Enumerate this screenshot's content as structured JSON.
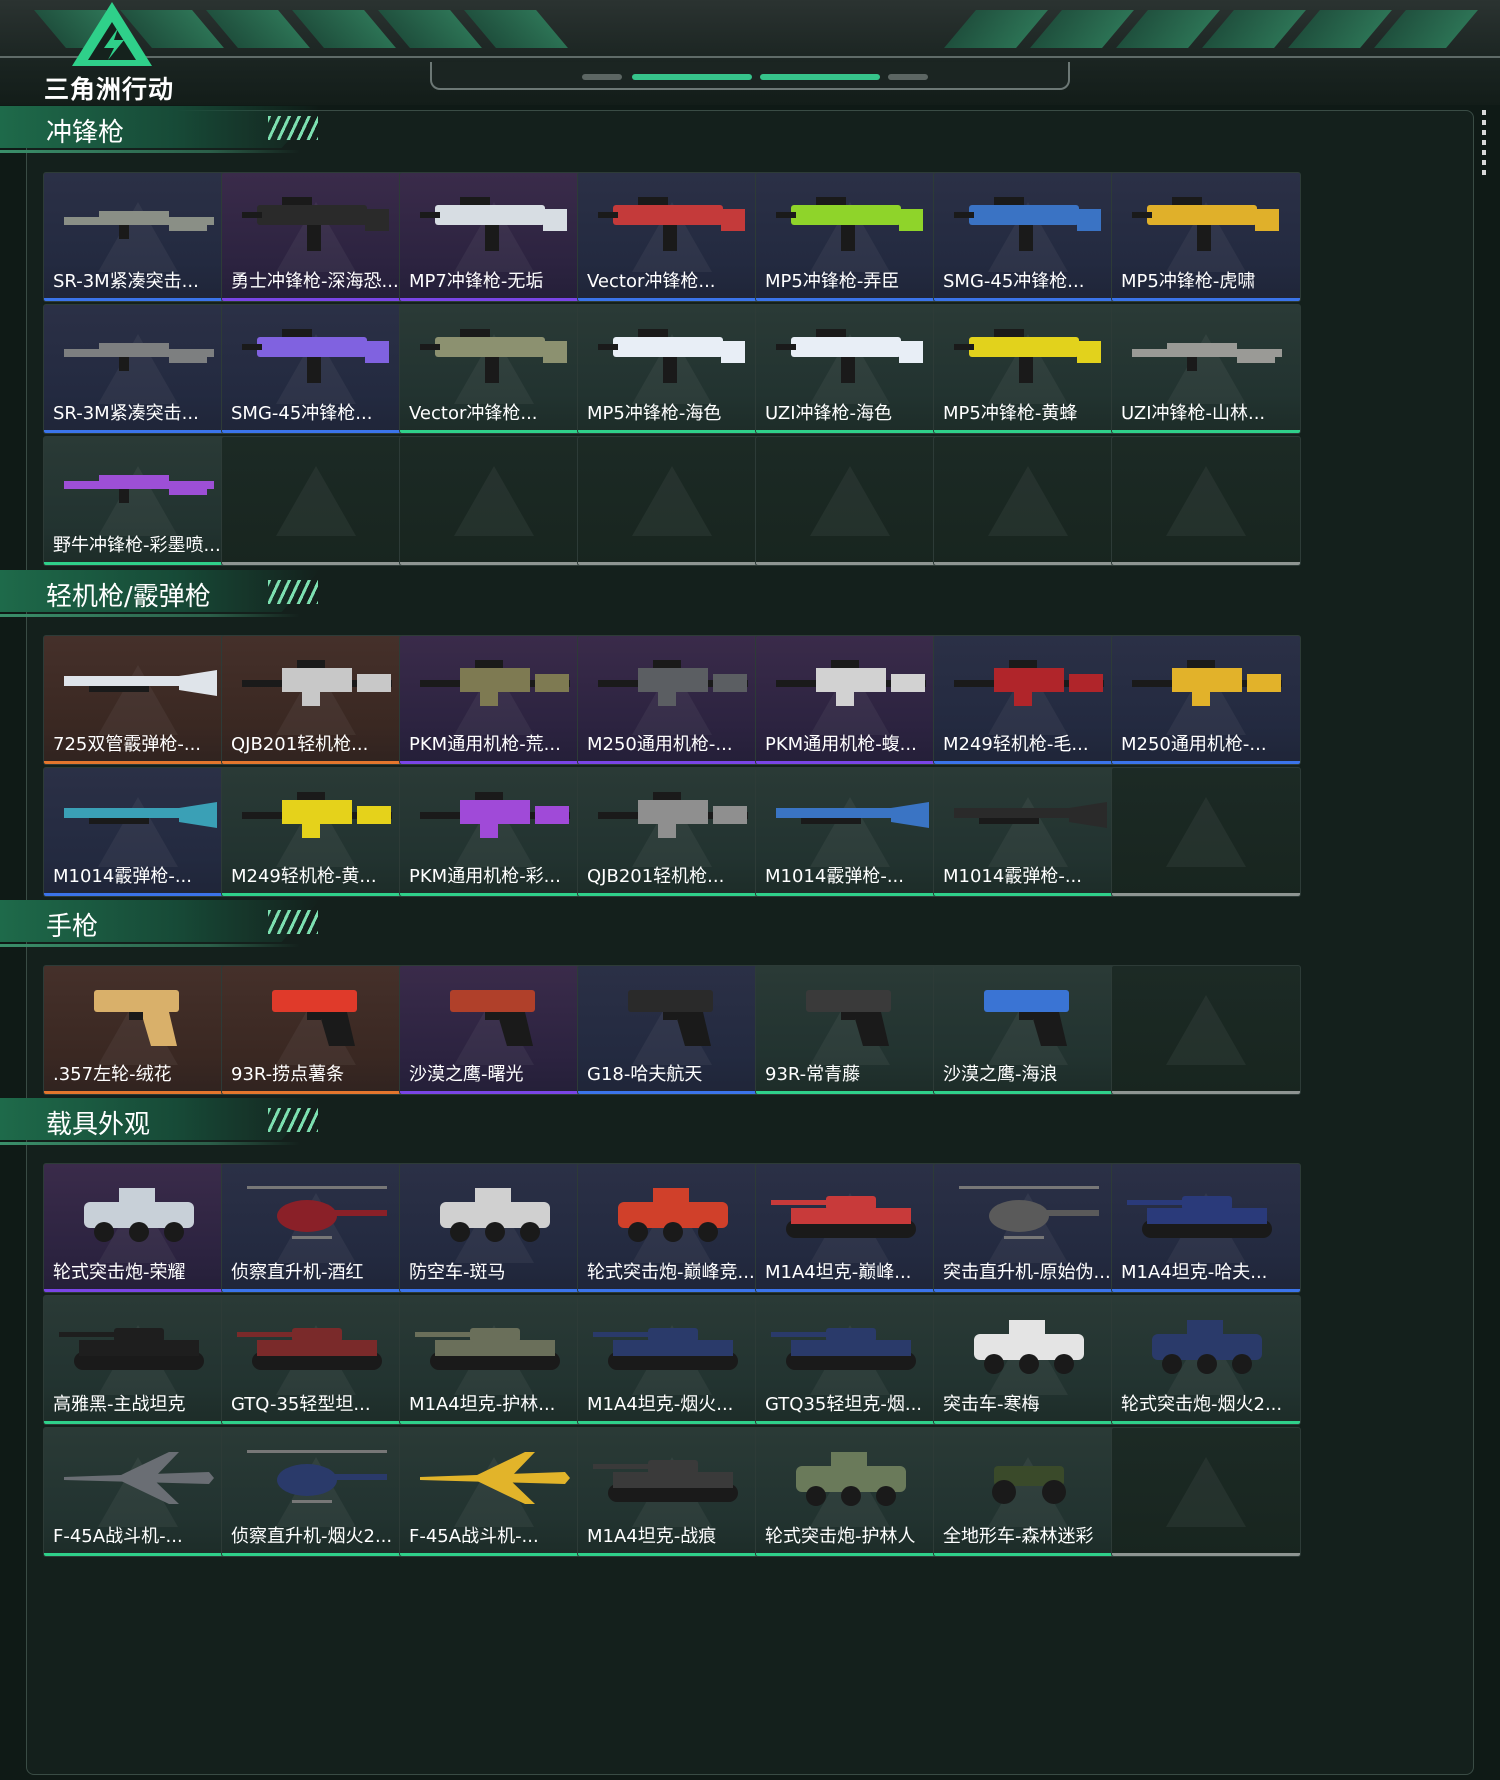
{
  "logo": {
    "text": "三角洲行动"
  },
  "sections": [
    {
      "title": "冲锋枪",
      "items": [
        {
          "label": "SR-3M紧凑突击...",
          "rarity": "blue",
          "icon": "rifle-icon",
          "color": "#8a8f86"
        },
        {
          "label": "勇士冲锋枪-深海恐...",
          "rarity": "purple",
          "icon": "smg-icon",
          "color": "#2a2a2a"
        },
        {
          "label": "MP7冲锋枪-无垢",
          "rarity": "purple",
          "icon": "smg-icon",
          "color": "#d7dde3"
        },
        {
          "label": "Vector冲锋枪...",
          "rarity": "blue",
          "icon": "smg-icon",
          "color": "#c43a3a"
        },
        {
          "label": "MP5冲锋枪-弄臣",
          "rarity": "blue",
          "icon": "smg-icon",
          "color": "#8fd42a"
        },
        {
          "label": "SMG-45冲锋枪...",
          "rarity": "blue",
          "icon": "smg-icon",
          "color": "#3a73c4"
        },
        {
          "label": "MP5冲锋枪-虎啸",
          "rarity": "blue",
          "icon": "smg-icon",
          "color": "#e0b02a"
        },
        {
          "label": "SR-3M紧凑突击...",
          "rarity": "blue",
          "icon": "rifle-icon",
          "color": "#7d7f80"
        },
        {
          "label": "SMG-45冲锋枪...",
          "rarity": "blue",
          "icon": "smg-icon",
          "color": "#8062e0"
        },
        {
          "label": "Vector冲锋枪...",
          "rarity": "green",
          "icon": "smg-icon",
          "color": "#8c9170"
        },
        {
          "label": "MP5冲锋枪-海色",
          "rarity": "green",
          "icon": "smg-icon",
          "color": "#e8eef6"
        },
        {
          "label": "UZI冲锋枪-海色",
          "rarity": "green",
          "icon": "smg-icon",
          "color": "#e8eef6"
        },
        {
          "label": "MP5冲锋枪-黄蜂",
          "rarity": "green",
          "icon": "smg-icon",
          "color": "#e2d21c"
        },
        {
          "label": "UZI冲锋枪-山林...",
          "rarity": "green",
          "icon": "rifle-icon",
          "color": "#9a9a96"
        },
        {
          "label": "野牛冲锋枪-彩墨喷...",
          "rarity": "green",
          "icon": "rifle-icon",
          "color": "#9d4fd6"
        },
        {
          "label": "",
          "rarity": "empty"
        },
        {
          "label": "",
          "rarity": "empty"
        },
        {
          "label": "",
          "rarity": "empty"
        },
        {
          "label": "",
          "rarity": "empty"
        },
        {
          "label": "",
          "rarity": "empty"
        },
        {
          "label": "",
          "rarity": "empty"
        }
      ]
    },
    {
      "title": "轻机枪/霰弹枪",
      "items": [
        {
          "label": "725双管霰弹枪-...",
          "rarity": "orange",
          "icon": "shotgun-icon",
          "color": "#dfe4ea"
        },
        {
          "label": "QJB201轻机枪...",
          "rarity": "orange",
          "icon": "lmg-icon",
          "color": "#c8c8c8"
        },
        {
          "label": "PKM通用机枪-荒...",
          "rarity": "purple",
          "icon": "lmg-icon",
          "color": "#7e7a52"
        },
        {
          "label": "M250通用机枪-...",
          "rarity": "purple",
          "icon": "lmg-icon",
          "color": "#5b5e62"
        },
        {
          "label": "PKM通用机枪-蝮...",
          "rarity": "purple",
          "icon": "lmg-icon",
          "color": "#d2d2d2"
        },
        {
          "label": "M249轻机枪-毛...",
          "rarity": "blue",
          "icon": "lmg-icon",
          "color": "#b0252a"
        },
        {
          "label": "M250通用机枪-...",
          "rarity": "blue",
          "icon": "lmg-icon",
          "color": "#e2b22a"
        },
        {
          "label": "M1014霰弹枪-...",
          "rarity": "blue",
          "icon": "shotgun-icon",
          "color": "#3aa0b6"
        },
        {
          "label": "M249轻机枪-黄...",
          "rarity": "green",
          "icon": "lmg-icon",
          "color": "#e5d21b"
        },
        {
          "label": "PKM通用机枪-彩...",
          "rarity": "green",
          "icon": "lmg-icon",
          "color": "#a04ad8"
        },
        {
          "label": "QJB201轻机枪...",
          "rarity": "green",
          "icon": "lmg-icon",
          "color": "#8f8f8f"
        },
        {
          "label": "M1014霰弹枪-...",
          "rarity": "green",
          "icon": "shotgun-icon",
          "color": "#3a74c4"
        },
        {
          "label": "M1014霰弹枪-...",
          "rarity": "green",
          "icon": "shotgun-icon",
          "color": "#2a2a2a"
        },
        {
          "label": "",
          "rarity": "empty"
        }
      ]
    },
    {
      "title": "手枪",
      "items": [
        {
          "label": ".357左轮-绒花",
          "rarity": "orange",
          "icon": "revolver-icon",
          "color": "#d9b06a"
        },
        {
          "label": "93R-捞点薯条",
          "rarity": "orange",
          "icon": "pistol-icon",
          "color": "#e03a2a"
        },
        {
          "label": "沙漠之鹰-曙光",
          "rarity": "purple",
          "icon": "pistol-icon",
          "color": "#b0402a"
        },
        {
          "label": "G18-哈夫航天",
          "rarity": "blue",
          "icon": "pistol-icon",
          "color": "#2a2a2a"
        },
        {
          "label": "93R-常青藤",
          "rarity": "green",
          "icon": "pistol-icon",
          "color": "#3a3a3a"
        },
        {
          "label": "沙漠之鹰-海浪",
          "rarity": "green",
          "icon": "pistol-icon",
          "color": "#3a74d4"
        },
        {
          "label": "",
          "rarity": "empty"
        }
      ]
    },
    {
      "title": "载具外观",
      "items": [
        {
          "label": "轮式突击炮-荣耀",
          "rarity": "purple",
          "icon": "armored-car-icon",
          "color": "#c8d0d8"
        },
        {
          "label": "侦察直升机-酒红",
          "rarity": "blue",
          "icon": "helicopter-icon",
          "color": "#8a2028"
        },
        {
          "label": "防空车-斑马",
          "rarity": "blue",
          "icon": "armored-car-icon",
          "color": "#d0d0d0"
        },
        {
          "label": "轮式突击炮-巅峰竞...",
          "rarity": "blue",
          "icon": "armored-car-icon",
          "color": "#d0402a"
        },
        {
          "label": "M1A4坦克-巅峰...",
          "rarity": "blue",
          "icon": "tank-icon",
          "color": "#c83a3a"
        },
        {
          "label": "突击直升机-原始伪...",
          "rarity": "blue",
          "icon": "helicopter-icon",
          "color": "#5a5a5a"
        },
        {
          "label": "M1A4坦克-哈夫...",
          "rarity": "blue",
          "icon": "tank-icon",
          "color": "#2a3a7a"
        },
        {
          "label": "高雅黑-主战坦克",
          "rarity": "green",
          "icon": "tank-icon",
          "color": "#1e1e1e"
        },
        {
          "label": "GTQ-35轻型坦...",
          "rarity": "green",
          "icon": "tank-icon",
          "color": "#7a2a2a"
        },
        {
          "label": "M1A4坦克-护林...",
          "rarity": "green",
          "icon": "tank-icon",
          "color": "#6a6f5a"
        },
        {
          "label": "M1A4坦克-烟火...",
          "rarity": "green",
          "icon": "tank-icon",
          "color": "#2a3a6a"
        },
        {
          "label": "GTQ35轻坦克-烟...",
          "rarity": "green",
          "icon": "tank-icon",
          "color": "#2a3a6a"
        },
        {
          "label": "突击车-寒梅",
          "rarity": "green",
          "icon": "armored-car-icon",
          "color": "#e4e4e4"
        },
        {
          "label": "轮式突击炮-烟火2...",
          "rarity": "green",
          "icon": "armored-car-icon",
          "color": "#2a3a6a"
        },
        {
          "label": "F-45A战斗机-...",
          "rarity": "green",
          "icon": "jet-icon",
          "color": "#6a6e74"
        },
        {
          "label": "侦察直升机-烟火2...",
          "rarity": "green",
          "icon": "helicopter-icon",
          "color": "#2a3a6a"
        },
        {
          "label": "F-45A战斗机-...",
          "rarity": "green",
          "icon": "jet-icon",
          "color": "#e2b42a"
        },
        {
          "label": "M1A4坦克-战痕",
          "rarity": "green",
          "icon": "tank-icon",
          "color": "#3a3a3a"
        },
        {
          "label": "轮式突击炮-护林人",
          "rarity": "green",
          "icon": "armored-car-icon",
          "color": "#6a7a5a"
        },
        {
          "label": "全地形车-森林迷彩",
          "rarity": "green",
          "icon": "atv-icon",
          "color": "#3a4a2a"
        },
        {
          "label": "",
          "rarity": "empty"
        }
      ]
    }
  ]
}
